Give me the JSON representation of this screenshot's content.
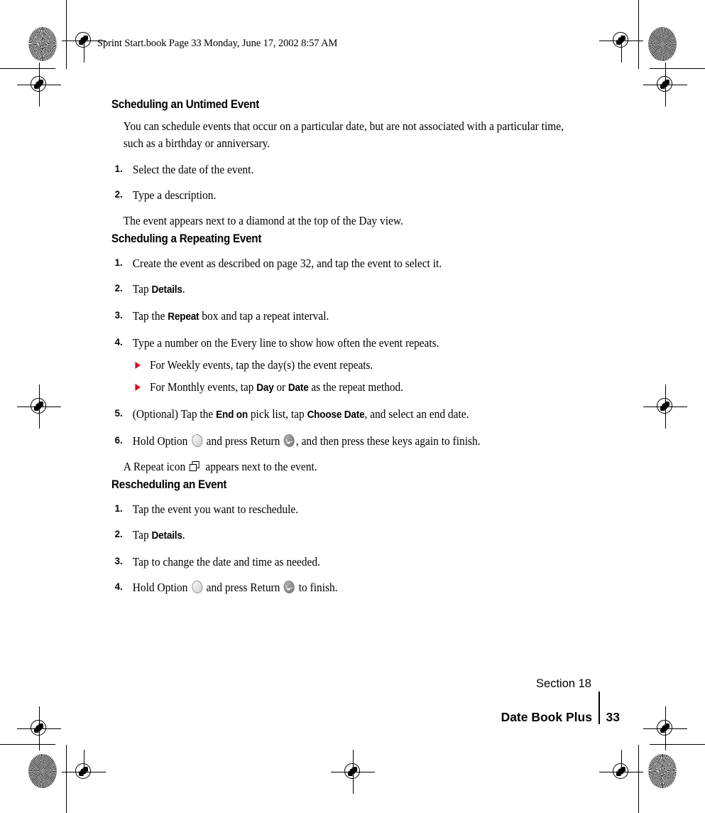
{
  "header": {
    "running_text": "Sprint Start.book  Page 33  Monday, June 17, 2002  8:57 AM"
  },
  "colors": {
    "bullet_red": "#e3001b",
    "text": "#000000",
    "page_background": "#ffffff"
  },
  "sections": [
    {
      "heading": "Scheduling an Untimed Event",
      "intro": "You can schedule events that occur on a particular date, but are not associated with a particular time, such as a birthday or anniversary.",
      "steps": [
        {
          "num": "1.",
          "text": "Select the date of the event."
        },
        {
          "num": "2.",
          "text": "Type a description."
        }
      ],
      "closing": "The event appears next to a diamond at the top of the Day view."
    },
    {
      "heading": "Scheduling a Repeating Event",
      "steps": [
        {
          "num": "1.",
          "text": "Create the event as described on page 32, and tap the event to select it."
        },
        {
          "num": "2.",
          "pre": "Tap ",
          "bold": "Details",
          "post": "."
        },
        {
          "num": "3.",
          "pre": "Tap the ",
          "bold": "Repeat",
          "post": " box and tap a repeat interval."
        },
        {
          "num": "4.",
          "text": "Type a number on the Every line to show how often the event repeats.",
          "subs": [
            {
              "text": "For Weekly events, tap the day(s) the event repeats."
            },
            {
              "pre": "For Monthly events, tap ",
              "bold": "Day",
              "mid": " or ",
              "bold2": "Date",
              "post": " as the repeat method."
            }
          ]
        },
        {
          "num": "5.",
          "pre": "(Optional) Tap the ",
          "bold": "End on",
          "mid": " pick list, tap ",
          "bold2": "Choose Date",
          "post": ", and select an end date."
        },
        {
          "num": "6.",
          "pre": "Hold Option ",
          "mid": " and press Return ",
          "post": ", and then press these keys again to finish."
        }
      ],
      "closing_pre": "A Repeat icon ",
      "closing_post": " appears next to the event."
    },
    {
      "heading": "Rescheduling an Event",
      "steps": [
        {
          "num": "1.",
          "text": "Tap the event you want to reschedule."
        },
        {
          "num": "2.",
          "pre": "Tap ",
          "bold": "Details",
          "post": "."
        },
        {
          "num": "3.",
          "text": "Tap to change the date and time as needed."
        },
        {
          "num": "4.",
          "pre": "Hold Option ",
          "mid": " and press Return ",
          "post": " to finish."
        }
      ]
    }
  ],
  "footer": {
    "section_label": "Section 18",
    "book_title": "Date Book Plus",
    "page_number": "33"
  },
  "icons": {
    "option_key": "option-key-icon",
    "return_key": "return-key-icon",
    "repeat": "repeat-icon",
    "sub_bullet": "red-triangle-bullet-icon",
    "registration": "registration-crosshair-icon",
    "rosette": "print-rosette-target-icon"
  }
}
